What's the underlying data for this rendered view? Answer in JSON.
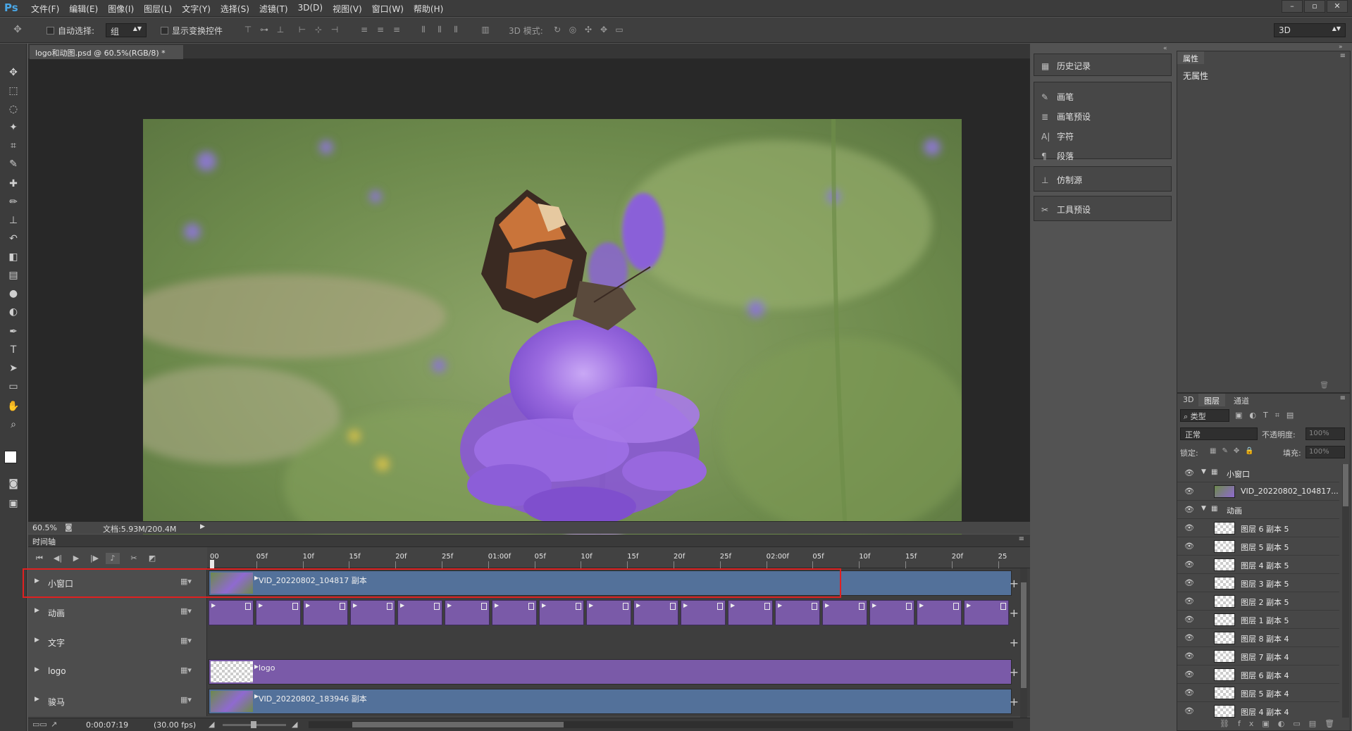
{
  "menubar": {
    "app_logo": "Ps",
    "items": [
      "文件(F)",
      "编辑(E)",
      "图像(I)",
      "图层(L)",
      "文字(Y)",
      "选择(S)",
      "滤镜(T)",
      "3D(D)",
      "视图(V)",
      "窗口(W)",
      "帮助(H)"
    ],
    "window_buttons": [
      "–",
      "▫",
      "✕"
    ]
  },
  "optbar": {
    "auto_select_label": "自动选择:",
    "auto_select_value": "组",
    "show_transform_label": "显示变换控件",
    "mode_3d_label": "3D 模式:",
    "workspace_value": "3D"
  },
  "document": {
    "tab_title": "logo和动图.psd @ 60.5%(RGB/8) *",
    "close": "×"
  },
  "status": {
    "zoom": "60.5%",
    "doc_size": "文档:5.93M/200.4M"
  },
  "timeline": {
    "panel_title": "时间轴",
    "ruler_ticks": [
      "00",
      "05f",
      "10f",
      "15f",
      "20f",
      "25f",
      "01:00f",
      "05f",
      "10f",
      "15f",
      "20f",
      "25f",
      "02:00f",
      "05f",
      "10f",
      "15f",
      "20f",
      "25"
    ],
    "tracks": [
      {
        "name": "小窗口",
        "clip": "VID_20220802_104817 副本",
        "kind": "video",
        "highlight": true
      },
      {
        "name": "动画",
        "clip": "",
        "kind": "frames",
        "highlight": false
      },
      {
        "name": "文字",
        "clip": "",
        "kind": "empty",
        "highlight": false
      },
      {
        "name": "logo",
        "clip": "logo",
        "kind": "image",
        "highlight": false
      },
      {
        "name": "骏马",
        "clip": "VID_20220802_183946 副本",
        "kind": "video",
        "highlight": false
      }
    ],
    "timecode": "0:00:07:19",
    "fps": "(30.00 fps)"
  },
  "midpanel": {
    "group1": [
      {
        "icon": "history-icon",
        "label": "历史记录"
      }
    ],
    "group2": [
      {
        "icon": "brush-icon",
        "label": "画笔"
      },
      {
        "icon": "brush-preset-icon",
        "label": "画笔预设"
      },
      {
        "icon": "character-icon",
        "label": "字符"
      },
      {
        "icon": "paragraph-icon",
        "label": "段落"
      }
    ],
    "group3": [
      {
        "icon": "clone-source-icon",
        "label": "仿制源"
      }
    ],
    "group4": [
      {
        "icon": "tool-preset-icon",
        "label": "工具预设"
      }
    ]
  },
  "properties": {
    "tab": "属性",
    "content": "无属性"
  },
  "layers": {
    "tabs": [
      "3D",
      "图层",
      "通道"
    ],
    "filter_label": "类型",
    "blend_mode": "正常",
    "opacity_label": "不透明度:",
    "opacity_value": "100%",
    "lock_label": "锁定:",
    "fill_label": "填充:",
    "fill_value": "100%",
    "rows": [
      {
        "type": "group",
        "name": "小窗口"
      },
      {
        "type": "video",
        "name": "VID_20220802_104817..."
      },
      {
        "type": "group",
        "name": "动画"
      },
      {
        "type": "layer",
        "name": "图层 6 副本 5"
      },
      {
        "type": "layer",
        "name": "图层 5 副本 5"
      },
      {
        "type": "layer",
        "name": "图层 4 副本 5"
      },
      {
        "type": "layer",
        "name": "图层 3 副本 5"
      },
      {
        "type": "layer",
        "name": "图层 2 副本 5"
      },
      {
        "type": "layer",
        "name": "图层 1 副本 5"
      },
      {
        "type": "layer",
        "name": "图层 8 副本 4"
      },
      {
        "type": "layer",
        "name": "图层 7 副本 4"
      },
      {
        "type": "layer",
        "name": "图层 6 副本 4"
      },
      {
        "type": "layer",
        "name": "图层 5 副本 4"
      },
      {
        "type": "layer",
        "name": "图层 4 副本 4"
      }
    ]
  },
  "colors": {
    "highlight_border": "#e02020",
    "clip_blue": "#53719a",
    "clip_purple": "#7a5aa8"
  }
}
